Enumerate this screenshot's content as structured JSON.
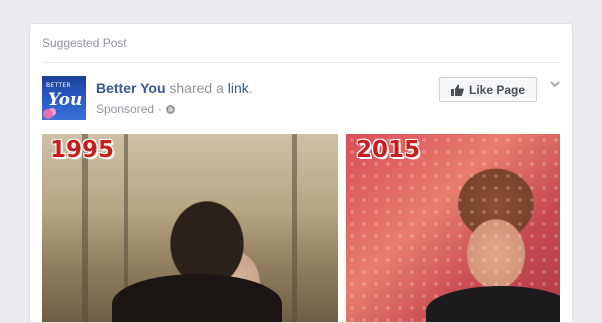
{
  "feed_card": {
    "suggested_label": "Suggested Post",
    "page": {
      "name": "Better You",
      "action_text": "shared a",
      "link_text": "link",
      "period": ".",
      "sponsored_label": "Sponsored",
      "separator": "·",
      "avatar": {
        "line1": "BETTER",
        "line2": "You",
        "colors": {
          "primary": "#2a5cc7",
          "accent": "#e46fb0"
        }
      }
    },
    "like_button": {
      "label": "Like Page",
      "icon": "thumbs-up-icon"
    },
    "options_icon": "chevron-down-icon",
    "privacy_icon": "globe-icon",
    "image": {
      "left_year": "1995",
      "right_year": "2015"
    }
  },
  "colors": {
    "link_blue": "#365899",
    "meta_gray": "#90949c",
    "year_red": "#c81e1e",
    "page_bg": "#e9ebee"
  }
}
